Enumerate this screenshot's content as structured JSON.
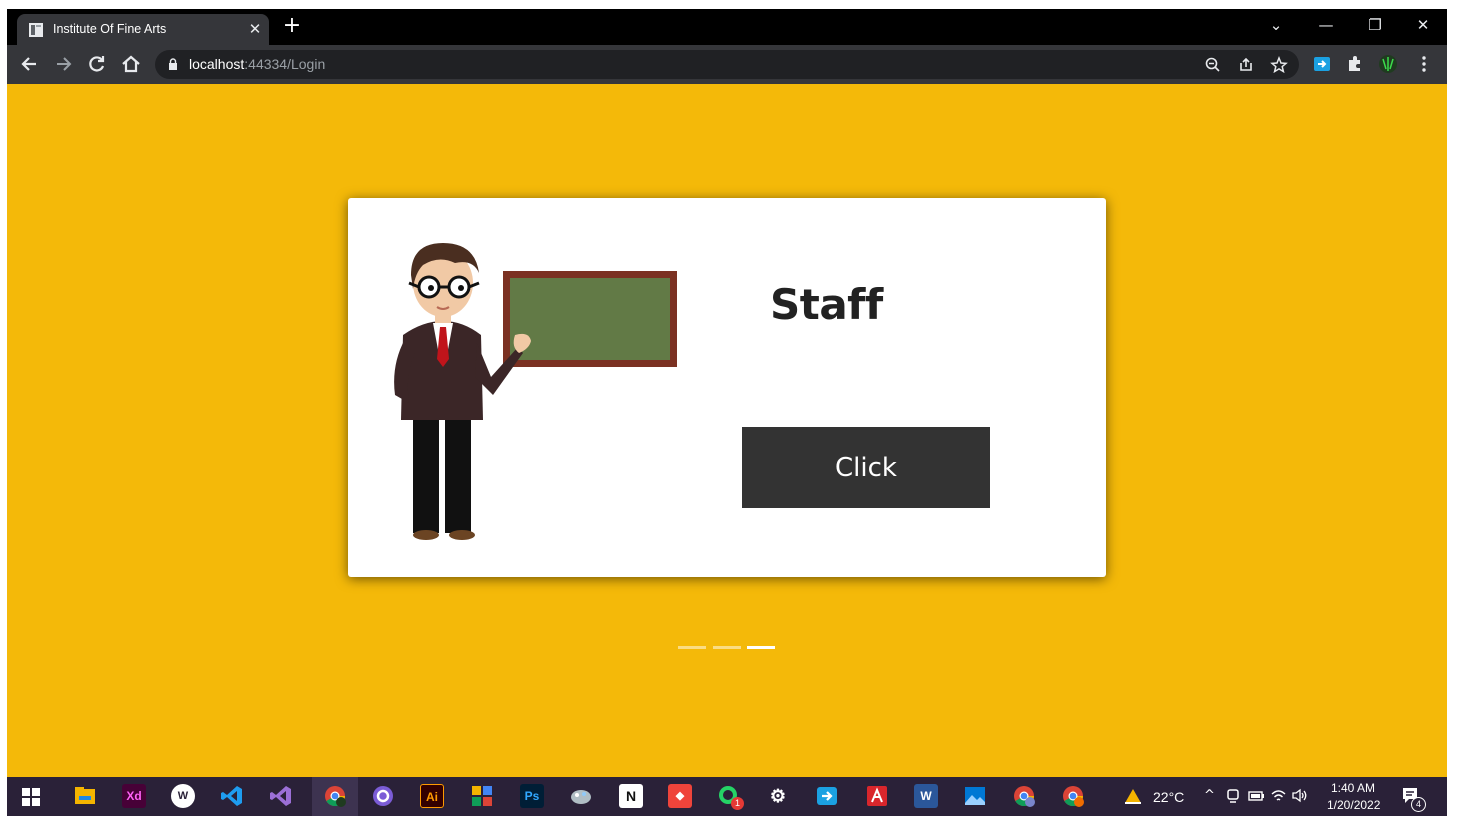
{
  "browser": {
    "tab": {
      "title": "Institute Of Fine Arts",
      "close": "✕"
    },
    "new_tab": "+",
    "window_controls": {
      "tab_search": "⌄",
      "minimize": "—",
      "restore": "❐",
      "close": "✕"
    },
    "address": {
      "host": "localhost",
      "path": ":44334/Login"
    },
    "icons": [
      "back-arrow-icon",
      "forward-arrow-icon",
      "reload-icon",
      "home-icon",
      "lock-icon",
      "zoom-icon",
      "share-icon",
      "bookmark-star-icon",
      "extension-icon",
      "puzzle-icon",
      "profile-icon",
      "menu-icon"
    ]
  },
  "card": {
    "title": "Staff",
    "button_label": "Click"
  },
  "carousel": {
    "count": 3,
    "active_index": 2
  },
  "colors": {
    "page_bg": "#f4b909",
    "card_bg": "#ffffff",
    "button_bg": "#333333",
    "board_green": "#627a46",
    "board_frame": "#7b3122",
    "taskbar_bg": "#2a2138"
  },
  "taskbar": {
    "apps": [
      {
        "name": "windows-start-icon",
        "glyph": ""
      },
      {
        "name": "file-explorer-icon",
        "glyph": ""
      },
      {
        "name": "adobe-xd-icon",
        "glyph": "Xd"
      },
      {
        "name": "app-w-icon",
        "glyph": "W"
      },
      {
        "name": "vscode-icon",
        "glyph": ""
      },
      {
        "name": "visual-studio-icon",
        "glyph": ""
      },
      {
        "name": "chrome-icon",
        "glyph": ""
      },
      {
        "name": "github-desktop-icon",
        "glyph": ""
      },
      {
        "name": "adobe-illustrator-icon",
        "glyph": "Ai"
      },
      {
        "name": "app-colorful-icon",
        "glyph": ""
      },
      {
        "name": "photoshop-icon",
        "glyph": "Ps"
      },
      {
        "name": "app-paint-icon",
        "glyph": ""
      },
      {
        "name": "notion-icon",
        "glyph": "N"
      },
      {
        "name": "anydesk-icon",
        "glyph": "◆"
      },
      {
        "name": "whatsapp-icon",
        "glyph": ""
      },
      {
        "name": "settings-icon",
        "glyph": "⚙"
      },
      {
        "name": "app-arrow-icon",
        "glyph": ""
      },
      {
        "name": "acrobat-icon",
        "glyph": ""
      },
      {
        "name": "word-icon",
        "glyph": "W"
      },
      {
        "name": "photos-icon",
        "glyph": ""
      },
      {
        "name": "chrome-profile-2-icon",
        "glyph": ""
      },
      {
        "name": "chrome-profile-3-icon",
        "glyph": ""
      }
    ],
    "whatsapp_badge": "1",
    "weather": "22°C",
    "time": "1:40 AM",
    "date": "1/20/2022",
    "notification_count": "4"
  }
}
